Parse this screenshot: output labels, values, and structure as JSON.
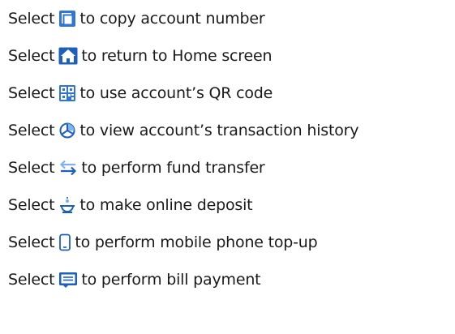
{
  "colors": {
    "text": "#1a1a1a",
    "icon_dark": "#1d5fbf",
    "icon_light": "#7fb3ec",
    "icon_fill": "#2f75d6"
  },
  "items": [
    {
      "prefix": "Select",
      "icon": "copy-icon",
      "text": "to copy account number"
    },
    {
      "prefix": "Select",
      "icon": "home-icon",
      "text": "to return to Home screen"
    },
    {
      "prefix": "Select",
      "icon": "qr-code-icon",
      "text": "to use account’s QR code"
    },
    {
      "prefix": "Select",
      "icon": "transaction-history-icon",
      "text": "to view account’s transaction history"
    },
    {
      "prefix": "Select",
      "icon": "fund-transfer-icon",
      "text": "to perform fund transfer"
    },
    {
      "prefix": "Select",
      "icon": "online-deposit-icon",
      "text": "to make online deposit"
    },
    {
      "prefix": "Select",
      "icon": "mobile-top-up-icon",
      "text": "to perform mobile phone top-up"
    },
    {
      "prefix": "Select",
      "icon": "bill-payment-icon",
      "text": "to perform bill payment"
    }
  ]
}
